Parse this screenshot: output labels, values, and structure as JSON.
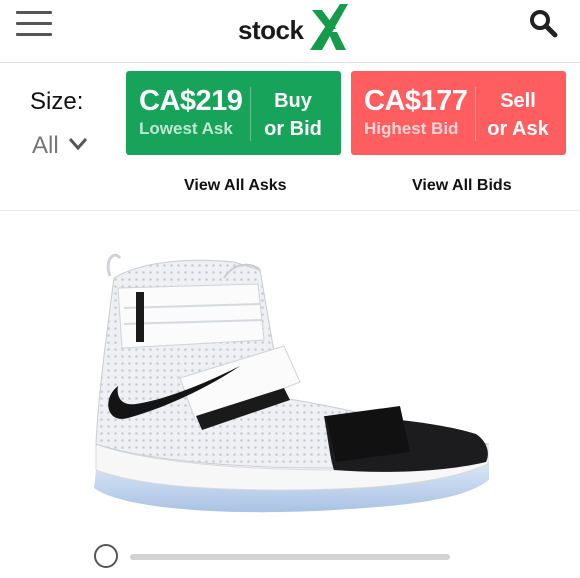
{
  "header": {
    "logo_text": "stock",
    "logo_mark": "X",
    "menu_icon": "hamburger-menu-icon",
    "search_icon": "search-icon"
  },
  "size": {
    "label": "Size:",
    "selected": "All",
    "chevron_icon": "chevron-down-icon"
  },
  "ask": {
    "price": "CA$219",
    "caption": "Lowest Ask",
    "action_line1": "Buy",
    "action_line2": "or Bid",
    "color": "#17a35a"
  },
  "bid": {
    "price": "CA$177",
    "caption": "Highest Bid",
    "action_line1": "Sell",
    "action_line2": "or Ask",
    "color": "#ff5e61"
  },
  "links": {
    "view_asks": "View All Asks",
    "view_bids": "View All Bids"
  },
  "colors": {
    "logo_green": "#159b49",
    "divider": "#e6e6e6"
  },
  "product": {
    "image_icon": "high-top-basketball-sneaker-image"
  },
  "carousel": {
    "radio_icon": "radio-circle-icon",
    "slider": "image-slider-track"
  }
}
